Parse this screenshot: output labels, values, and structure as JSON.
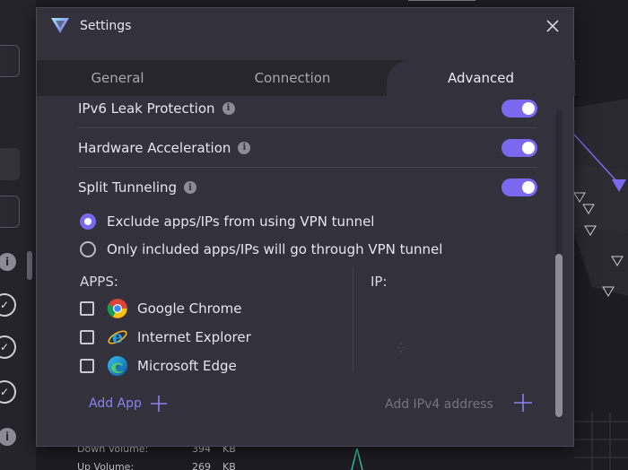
{
  "window": {
    "title": "Settings"
  },
  "tabs": [
    {
      "label": "General",
      "active": false
    },
    {
      "label": "Connection",
      "active": false
    },
    {
      "label": "Advanced",
      "active": true
    }
  ],
  "settings": {
    "ipv6": {
      "label": "IPv6 Leak Protection",
      "enabled": true
    },
    "hw_accel": {
      "label": "Hardware Acceleration",
      "enabled": true
    },
    "split_tunneling": {
      "label": "Split Tunneling",
      "enabled": true
    }
  },
  "split_mode": {
    "exclude_label": "Exclude apps/IPs from using VPN tunnel",
    "include_label": "Only included apps/IPs will go through VPN tunnel",
    "selected": "exclude"
  },
  "apps": {
    "heading": "APPS:",
    "items": [
      {
        "name": "Google Chrome",
        "icon": "chrome-icon",
        "checked": false
      },
      {
        "name": "Internet Explorer",
        "icon": "internet-explorer-icon",
        "checked": false
      },
      {
        "name": "Microsoft Edge",
        "icon": "edge-icon",
        "checked": false
      }
    ],
    "add_label": "Add App"
  },
  "ip": {
    "heading": "IP:",
    "placeholder": "Add IPv4 address"
  },
  "background": {
    "stats": [
      {
        "label": "Down Volume:",
        "value": "394",
        "unit": "KB"
      },
      {
        "label": "Up Volume:",
        "value": "269",
        "unit": "KB"
      }
    ]
  },
  "colors": {
    "accent": "#7b68ee",
    "dialog_bg": "#33313b",
    "tab_bar_bg": "#27262d"
  }
}
